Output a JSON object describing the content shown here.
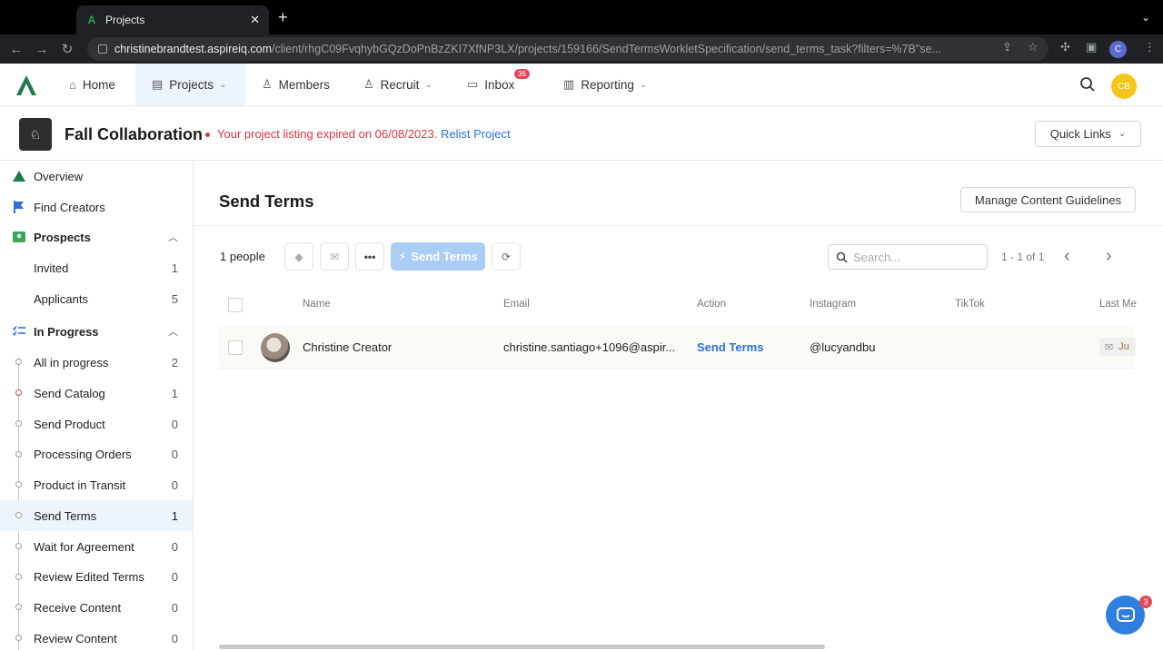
{
  "browser": {
    "tab_title": "Projects",
    "tab_favicon": "A",
    "new_tab": "+",
    "url_host": "christinebrandtest.aspireiq.com",
    "url_path": "/client/rhgC09FvqhybGQzDoPnBzZKI7XfNP3LX/projects/159166/SendTermsWorkletSpecification/send_terms_task?filters=%7B\"se...",
    "profile_initial": "C"
  },
  "appnav": {
    "items": [
      {
        "label": "Home",
        "icon": "home-icon"
      },
      {
        "label": "Projects",
        "icon": "projects-icon"
      },
      {
        "label": "Members",
        "icon": "members-icon"
      },
      {
        "label": "Recruit",
        "icon": "recruit-icon"
      },
      {
        "label": "Inbox",
        "icon": "inbox-icon"
      },
      {
        "label": "Reporting",
        "icon": "reporting-icon"
      }
    ],
    "inbox_badge": "36",
    "avatar_initials": "CB"
  },
  "project": {
    "name": "Fall Collaboration",
    "expired_text": "Your project listing expired on 06/08/2023.",
    "relist_label": "Relist Project",
    "quick_links_label": "Quick Links"
  },
  "sidebar": {
    "items": [
      {
        "label": "Overview",
        "count": ""
      },
      {
        "label": "Find Creators",
        "count": ""
      },
      {
        "label": "Prospects",
        "count": ""
      },
      {
        "label": "Invited",
        "count": "1"
      },
      {
        "label": "Applicants",
        "count": "5"
      },
      {
        "label": "In Progress",
        "count": ""
      },
      {
        "label": "All in progress",
        "count": "2"
      },
      {
        "label": "Send Catalog",
        "count": "1"
      },
      {
        "label": "Send Product",
        "count": "0"
      },
      {
        "label": "Processing Orders",
        "count": "0"
      },
      {
        "label": "Product in Transit",
        "count": "0"
      },
      {
        "label": "Send Terms",
        "count": "1"
      },
      {
        "label": "Wait for Agreement",
        "count": "0"
      },
      {
        "label": "Review Edited Terms",
        "count": "0"
      },
      {
        "label": "Receive Content",
        "count": "0"
      },
      {
        "label": "Review Content",
        "count": "0"
      }
    ]
  },
  "main": {
    "title": "Send Terms",
    "manage_guidelines_label": "Manage Content Guidelines",
    "people_count": "1 people",
    "send_terms_button": "Send Terms",
    "search_placeholder": "Search...",
    "pager_text": "1 - 1 of 1",
    "columns": [
      "Name",
      "Email",
      "Action",
      "Instagram",
      "TikTok",
      "Last Me"
    ],
    "rows": [
      {
        "name": "Christine Creator",
        "email": "christine.santiago+1096@aspir...",
        "action": "Send Terms",
        "instagram": "@lucyandbu",
        "tiktok": "",
        "last_message": "Ju"
      }
    ]
  },
  "chat": {
    "badge": "3"
  }
}
